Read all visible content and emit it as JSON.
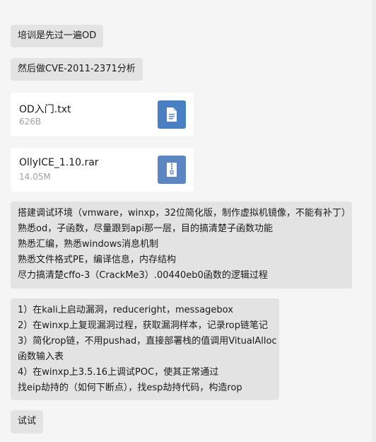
{
  "messages": {
    "m1": "培训是先过一遍OD",
    "m2": "然后做CVE-2011-2371分析",
    "file1": {
      "name": "OD入门.txt",
      "size": "626B",
      "icon": "text-file-icon",
      "color": "#4a7fc3"
    },
    "file2": {
      "name": "OllyICE_1.10.rar",
      "size": "14.05M",
      "icon": "archive-file-icon",
      "color": "#5b86c2"
    },
    "m3": [
      "搭建调试环境（vmware，winxp，32位简化版，制作虚拟机镜像，不能有补丁）",
      "熟悉od，子函数，尽量跟到api那一层，目的搞清楚子函数功能",
      "熟悉汇编，熟悉windows消息机制",
      "熟悉文件格式PE，编译信息，内存结构",
      "尽力搞清楚cffo-3（CrackMe3）.00440eb0函数的逻辑过程"
    ],
    "m4": [
      "1）在kali上启动漏洞，reduceright，messagebox",
      "2）在winxp上复现漏洞过程，获取漏洞样本，记录rop链笔记",
      "3）简化rop链，不用pushad，直接部署栈的值调用VitualAlloc",
      "函数输入表",
      "4）在winxp上3.5.16上调试POC，使其正常通过",
      "找eip劫持的（如何下断点），找esp劫持代码，构造rop"
    ],
    "m5": "试试"
  }
}
